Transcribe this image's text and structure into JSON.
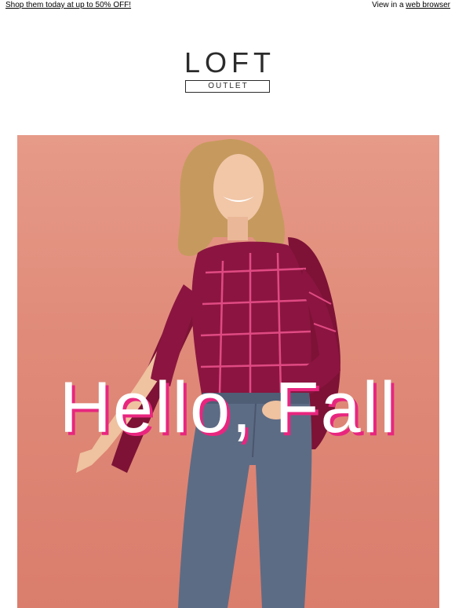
{
  "topbar": {
    "promo_link": "Shop them today at up to 50% OFF!",
    "view_prefix": "View in a ",
    "view_link": "web browser"
  },
  "logo": {
    "brand": "LOFT",
    "sub": "OUTLET"
  },
  "hero": {
    "headline": "Hello, Fall",
    "colors": {
      "background": "#e08a79",
      "headline_shadow": "#e8267f",
      "sweater": "#8b1540",
      "sweater_grid": "#e04a83",
      "jeans": "#5d6c85"
    }
  }
}
